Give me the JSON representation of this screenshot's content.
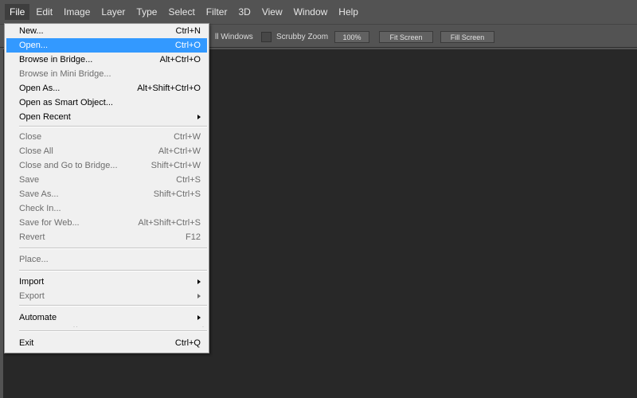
{
  "menubar": {
    "items": [
      "File",
      "Edit",
      "Image",
      "Layer",
      "Type",
      "Select",
      "Filter",
      "3D",
      "View",
      "Window",
      "Help"
    ]
  },
  "options_bar": {
    "scroll_all_windows": "ll Windows",
    "scrubby_zoom": "Scrubby Zoom",
    "zoom_percent": "100%",
    "fit_screen": "Fit Screen",
    "fill_screen": "Fill Screen"
  },
  "file_menu": {
    "new": {
      "label": "New...",
      "shortcut": "Ctrl+N"
    },
    "open": {
      "label": "Open...",
      "shortcut": "Ctrl+O"
    },
    "browse_bridge": {
      "label": "Browse in Bridge...",
      "shortcut": "Alt+Ctrl+O"
    },
    "browse_mini_bridge": {
      "label": "Browse in Mini Bridge..."
    },
    "open_as": {
      "label": "Open As...",
      "shortcut": "Alt+Shift+Ctrl+O"
    },
    "open_smart_object": {
      "label": "Open as Smart Object..."
    },
    "open_recent": {
      "label": "Open Recent"
    },
    "close": {
      "label": "Close",
      "shortcut": "Ctrl+W"
    },
    "close_all": {
      "label": "Close All",
      "shortcut": "Alt+Ctrl+W"
    },
    "close_go_bridge": {
      "label": "Close and Go to Bridge...",
      "shortcut": "Shift+Ctrl+W"
    },
    "save": {
      "label": "Save",
      "shortcut": "Ctrl+S"
    },
    "save_as": {
      "label": "Save As...",
      "shortcut": "Shift+Ctrl+S"
    },
    "check_in": {
      "label": "Check In..."
    },
    "save_for_web": {
      "label": "Save for Web...",
      "shortcut": "Alt+Shift+Ctrl+S"
    },
    "revert": {
      "label": "Revert",
      "shortcut": "F12"
    },
    "place": {
      "label": "Place..."
    },
    "import": {
      "label": "Import"
    },
    "export": {
      "label": "Export"
    },
    "automate": {
      "label": "Automate"
    },
    "exit": {
      "label": "Exit",
      "shortcut": "Ctrl+Q"
    }
  }
}
